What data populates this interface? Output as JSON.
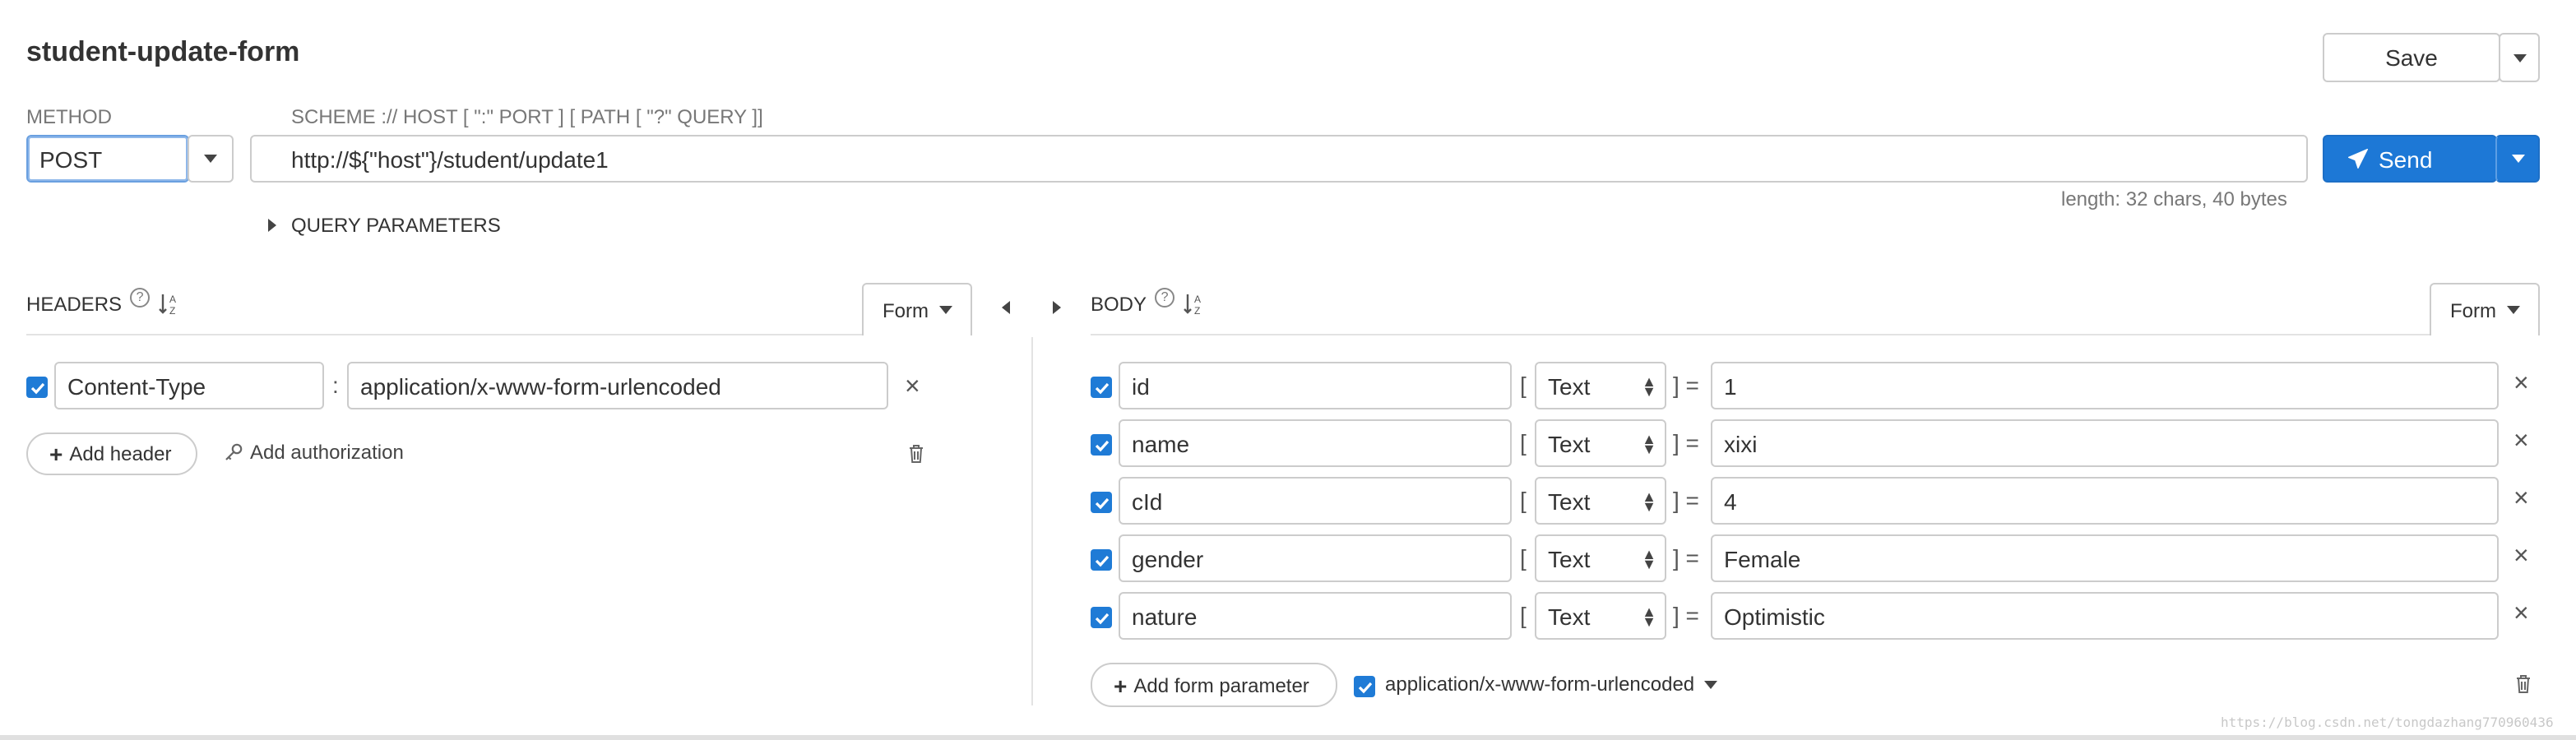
{
  "title": "student-update-form",
  "save_label": "Save",
  "method": {
    "label": "METHOD",
    "value": "POST"
  },
  "url": {
    "label": "SCHEME :// HOST [ \":\" PORT ] [ PATH [ \"?\" QUERY ]]",
    "value": "http://${\"host\"}/student/update1",
    "length_info": "length: 32 chars, 40 bytes"
  },
  "send_label": "Send",
  "query_params_label": "QUERY PARAMETERS",
  "headers": {
    "label": "HEADERS",
    "form_label": "Form",
    "items": [
      {
        "key": "Content-Type",
        "value": "application/x-www-form-urlencoded",
        "checked": true
      }
    ],
    "add_header_label": "Add header",
    "add_auth_label": "Add authorization"
  },
  "body": {
    "label": "BODY",
    "form_label": "Form",
    "params": [
      {
        "key": "id",
        "type": "Text",
        "value": "1",
        "checked": true
      },
      {
        "key": "name",
        "type": "Text",
        "value": "xixi",
        "checked": true
      },
      {
        "key": "cId",
        "type": "Text",
        "value": "4",
        "checked": true
      },
      {
        "key": "gender",
        "type": "Text",
        "value": "Female",
        "checked": true
      },
      {
        "key": "nature",
        "type": "Text",
        "value": "Optimistic",
        "checked": true
      }
    ],
    "add_param_label": "Add form parameter",
    "content_type": "application/x-www-form-urlencoded"
  },
  "watermark": "https://blog.csdn.net/tongdazhang770960436",
  "colors": {
    "accent": "#1d78d6",
    "border": "#cccccc"
  }
}
